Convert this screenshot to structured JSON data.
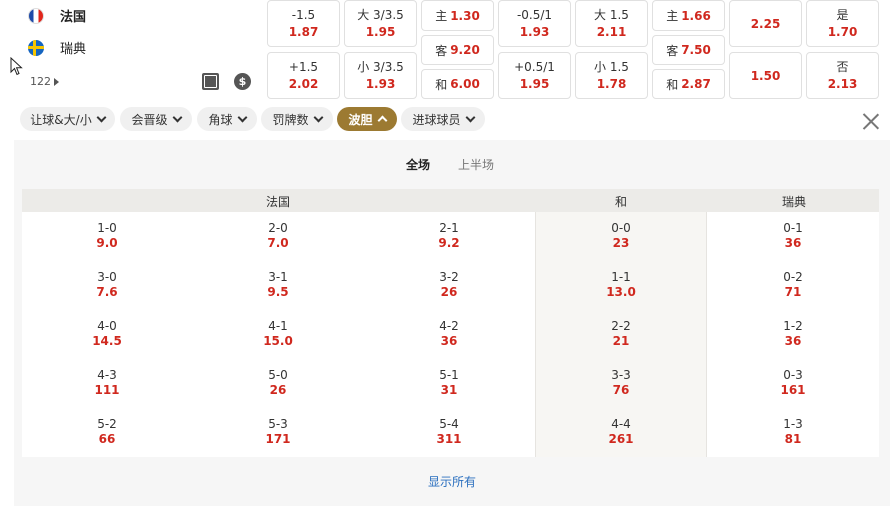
{
  "match": {
    "home_team": "法国",
    "away_team": "瑞典",
    "market_count": "122",
    "icons": [
      "flag-france-icon",
      "flag-sweden-icon",
      "pitch-icon",
      "money-icon",
      "play-triangle-icon"
    ]
  },
  "odds": {
    "handicap": [
      {
        "line": "-1.5",
        "odd": "1.87"
      },
      {
        "line": "+1.5",
        "odd": "2.02"
      }
    ],
    "totals": [
      {
        "line": "大 3/3.5",
        "odd": "1.95"
      },
      {
        "line": "小 3/3.5",
        "odd": "1.93"
      }
    ],
    "match_result": [
      {
        "label": "主",
        "odd": "1.30"
      },
      {
        "label": "客",
        "odd": "9.20"
      },
      {
        "label": "和",
        "odd": "6.00"
      }
    ],
    "half_handicap": [
      {
        "line": "-0.5/1",
        "odd": "1.93"
      },
      {
        "line": "+0.5/1",
        "odd": "1.95"
      }
    ],
    "half_totals": [
      {
        "line": "大 1.5",
        "odd": "2.11"
      },
      {
        "line": "小 1.5",
        "odd": "1.78"
      }
    ],
    "half_result": [
      {
        "label": "主",
        "odd": "1.66"
      },
      {
        "label": "客",
        "odd": "7.50"
      },
      {
        "label": "和",
        "odd": "2.87"
      }
    ],
    "extra": [
      {
        "odd": "2.25"
      },
      {
        "odd": "1.50"
      }
    ],
    "yes_no": [
      {
        "label": "是",
        "odd": "1.70"
      },
      {
        "label": "否",
        "odd": "2.13"
      }
    ]
  },
  "filters": {
    "chips": [
      {
        "label": "让球&大/小",
        "active": false
      },
      {
        "label": "会晋级",
        "active": false
      },
      {
        "label": "角球",
        "active": false
      },
      {
        "label": "罚牌数",
        "active": false
      },
      {
        "label": "波胆",
        "active": true
      },
      {
        "label": "进球球员",
        "active": false
      }
    ]
  },
  "panel": {
    "tabs": [
      {
        "label": "全场",
        "active": true
      },
      {
        "label": "上半场",
        "active": false
      }
    ],
    "headers": {
      "home": "法国",
      "draw": "和",
      "away": "瑞典"
    },
    "home_scores": [
      [
        {
          "score": "1-0",
          "odd": "9.0"
        },
        {
          "score": "2-0",
          "odd": "7.0"
        },
        {
          "score": "2-1",
          "odd": "9.2"
        }
      ],
      [
        {
          "score": "3-0",
          "odd": "7.6"
        },
        {
          "score": "3-1",
          "odd": "9.5"
        },
        {
          "score": "3-2",
          "odd": "26"
        }
      ],
      [
        {
          "score": "4-0",
          "odd": "14.5"
        },
        {
          "score": "4-1",
          "odd": "15.0"
        },
        {
          "score": "4-2",
          "odd": "36"
        }
      ],
      [
        {
          "score": "4-3",
          "odd": "111"
        },
        {
          "score": "5-0",
          "odd": "26"
        },
        {
          "score": "5-1",
          "odd": "31"
        }
      ],
      [
        {
          "score": "5-2",
          "odd": "66"
        },
        {
          "score": "5-3",
          "odd": "171"
        },
        {
          "score": "5-4",
          "odd": "311"
        }
      ]
    ],
    "draw_scores": [
      {
        "score": "0-0",
        "odd": "23"
      },
      {
        "score": "1-1",
        "odd": "13.0"
      },
      {
        "score": "2-2",
        "odd": "21"
      },
      {
        "score": "3-3",
        "odd": "76"
      },
      {
        "score": "4-4",
        "odd": "261"
      }
    ],
    "away_scores": [
      {
        "score": "0-1",
        "odd": "36"
      },
      {
        "score": "0-2",
        "odd": "71"
      },
      {
        "score": "1-2",
        "odd": "36"
      },
      {
        "score": "0-3",
        "odd": "161"
      },
      {
        "score": "1-3",
        "odd": "81"
      }
    ],
    "show_all": "显示所有"
  },
  "colors": {
    "odd_red": "#d0281e",
    "accent_gold": "#9c7a32",
    "link_blue": "#2a6fbf"
  }
}
